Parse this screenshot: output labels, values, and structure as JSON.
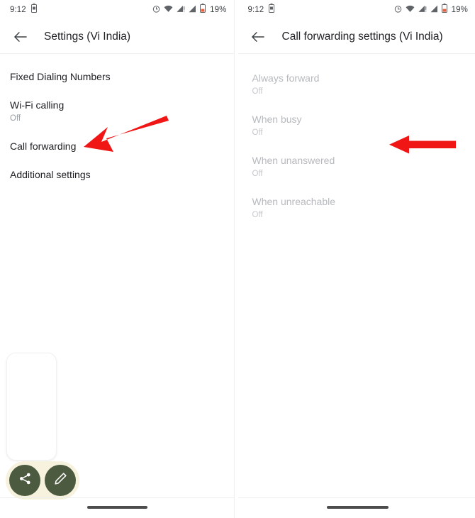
{
  "left_screen": {
    "status_bar": {
      "time": "9:12",
      "battery_percent": "19%",
      "icons": [
        "battery-saver-icon",
        "alarm-icon",
        "wifi-icon",
        "signal-sim1-icon",
        "signal-sim2-icon",
        "battery-icon"
      ]
    },
    "app_bar": {
      "back_label": "Back",
      "title": "Settings (Vi India)"
    },
    "list": [
      {
        "title": "Fixed Dialing Numbers",
        "subtitle": ""
      },
      {
        "title": "Wi-Fi calling",
        "subtitle": "Off"
      },
      {
        "title": "Call forwarding",
        "subtitle": ""
      },
      {
        "title": "Additional settings",
        "subtitle": ""
      }
    ],
    "screenshot_overlay": {
      "preview_label": "Screenshot preview",
      "share_label": "Share",
      "edit_label": "Edit"
    }
  },
  "right_screen": {
    "status_bar": {
      "time": "9:12",
      "battery_percent": "19%"
    },
    "app_bar": {
      "back_label": "Back",
      "title": "Call forwarding settings (Vi India)"
    },
    "list": [
      {
        "title": "Always forward",
        "subtitle": "Off"
      },
      {
        "title": "When busy",
        "subtitle": "Off"
      },
      {
        "title": "When unanswered",
        "subtitle": "Off"
      },
      {
        "title": "When unreachable",
        "subtitle": "Off"
      }
    ]
  },
  "annotations": [
    {
      "name": "arrow-call-forwarding",
      "direction": "down-left",
      "color": "#f11616"
    },
    {
      "name": "arrow-when-unanswered",
      "direction": "left",
      "color": "#f11616"
    }
  ],
  "colors": {
    "accent_green": "#4c5a3f",
    "pill_cream": "#f7f2dd",
    "arrow_red": "#f11616",
    "text_primary": "#202124",
    "text_secondary": "#9aa0a6",
    "text_disabled": "#b6b9bd"
  }
}
